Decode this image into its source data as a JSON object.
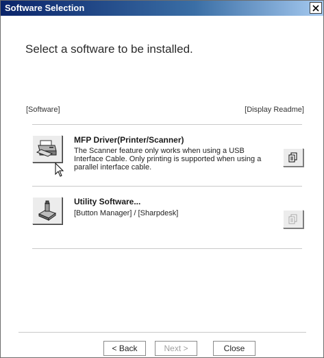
{
  "window": {
    "title": "Software Selection"
  },
  "heading": "Select a software to be installed.",
  "columns": {
    "left": "[Software]",
    "right": "[Display Readme]"
  },
  "items": [
    {
      "title": "MFP Driver(Printer/Scanner)",
      "description": "The Scanner feature only works when using a USB Interface Cable. Only printing is supported when using a parallel interface cable.",
      "icon": "printer-scanner-icon",
      "readme_enabled": true
    },
    {
      "title": "Utility Software...",
      "description": "[Button Manager] / [Sharpdesk]",
      "icon": "utility-software-icon",
      "readme_enabled": false
    }
  ],
  "footer": {
    "back": "< Back",
    "next": "Next >",
    "close": "Close"
  }
}
